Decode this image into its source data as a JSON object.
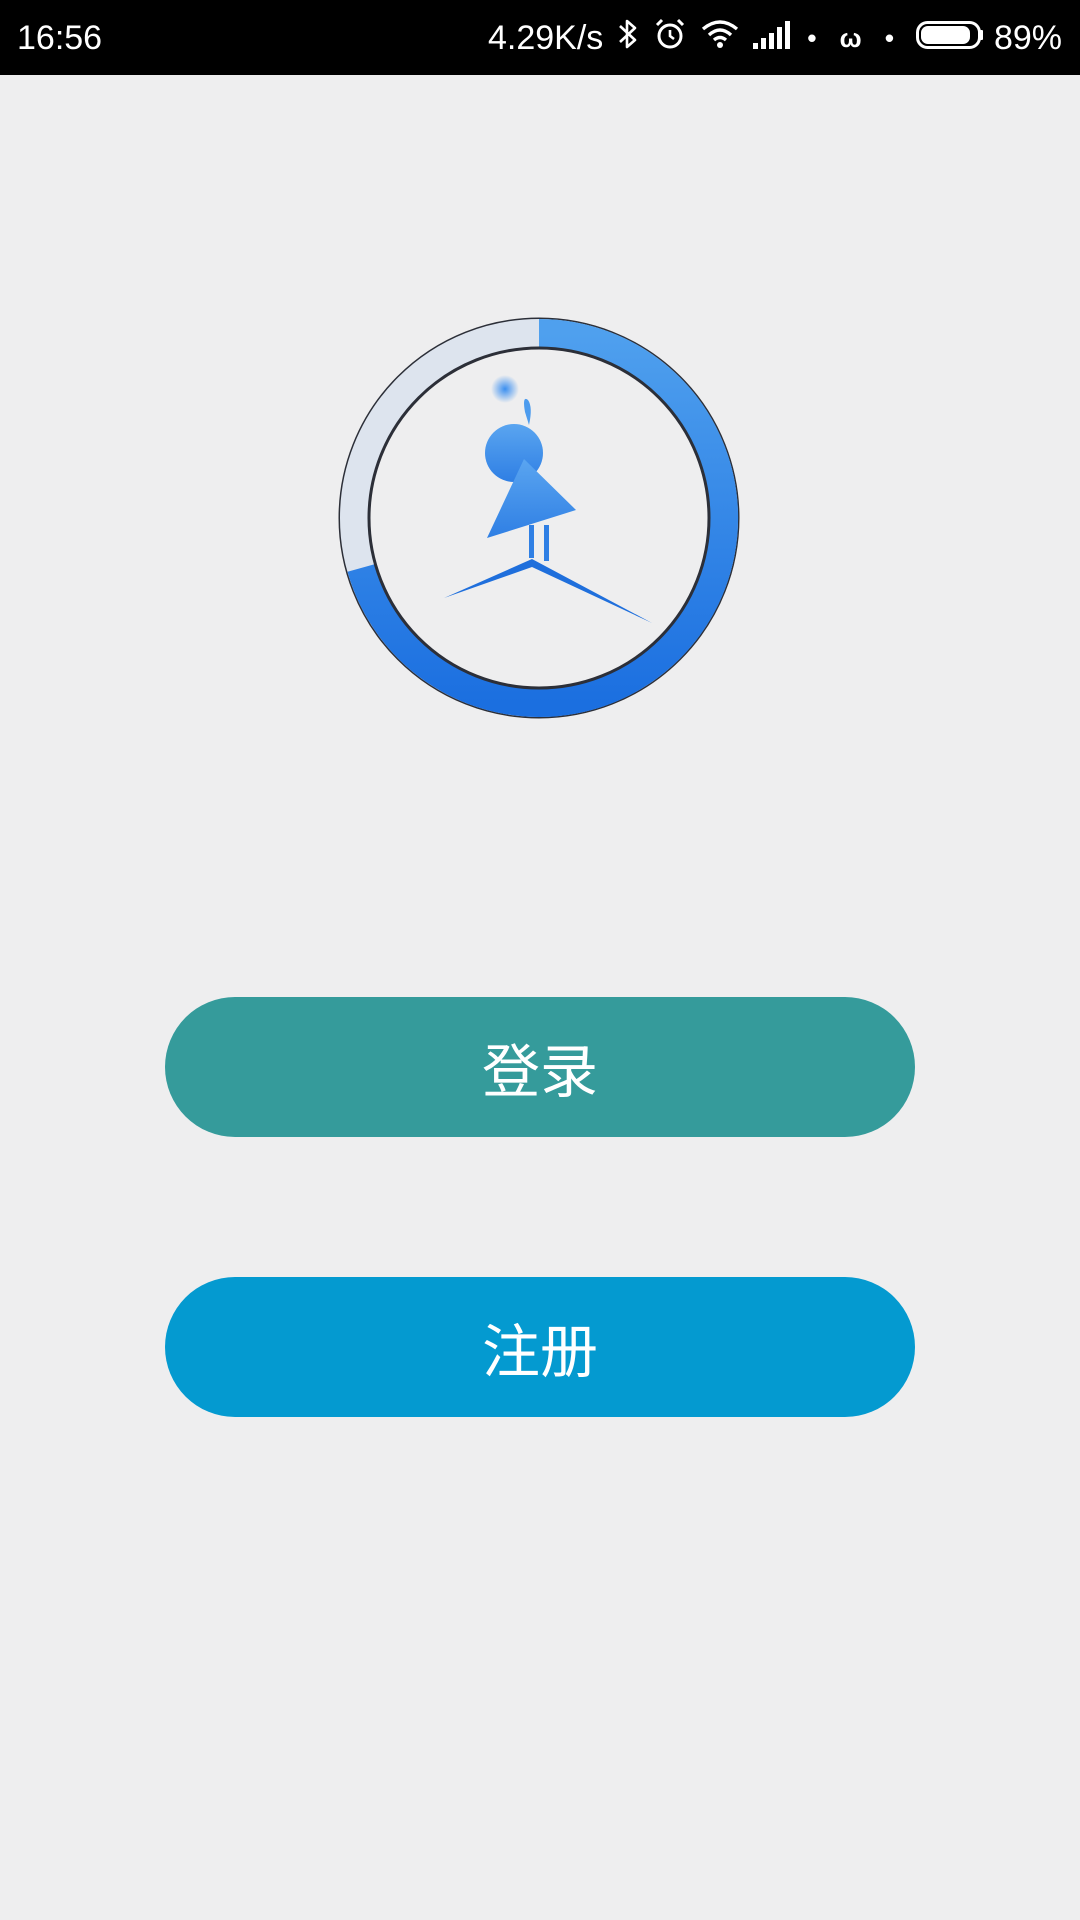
{
  "status_bar": {
    "time": "16:56",
    "network_speed": "4.29K/s",
    "icons": [
      "bluetooth-icon",
      "alarm-icon",
      "wifi-icon",
      "signal-icon",
      "battery-icon"
    ],
    "dots": "• ω •",
    "battery_percent": "89%",
    "battery_level": 0.89
  },
  "logo": {
    "name": "app-logo",
    "ring_color_light": "#4fa0ee",
    "ring_color_dark": "#1b6fe0"
  },
  "actions": {
    "login_label": "登录",
    "login_color": "#359b9b",
    "register_label": "注册",
    "register_color": "#049ad0"
  }
}
